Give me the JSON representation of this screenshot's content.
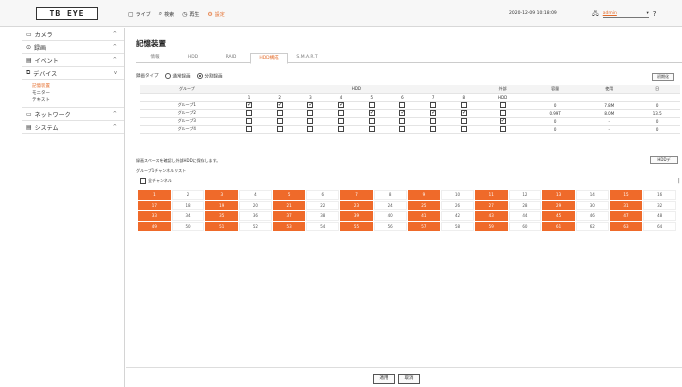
{
  "topbar": {
    "logo": "TB EYE",
    "nav": [
      {
        "icon": "live-icon",
        "glyph": "▢",
        "label": "ライブ",
        "active": false
      },
      {
        "icon": "search-icon",
        "glyph": "⌕",
        "label": "検索",
        "active": false
      },
      {
        "icon": "playback-icon",
        "glyph": "◷",
        "label": "再生",
        "active": false
      },
      {
        "icon": "settings-icon",
        "glyph": "⚙",
        "label": "設定",
        "active": true
      }
    ],
    "datetime": "2020-12-09 10:18:09",
    "user": "admin",
    "help": "?"
  },
  "sidebar": {
    "groups": [
      {
        "label": "カメラ",
        "glyph": "▭",
        "chevron": "^",
        "items": []
      },
      {
        "label": "録画",
        "glyph": "⊙",
        "chevron": "^",
        "items": []
      },
      {
        "label": "イベント",
        "glyph": "▤",
        "chevron": "^",
        "items": []
      },
      {
        "label": "デバイス",
        "glyph": "⧉",
        "chevron": "v",
        "items": [
          {
            "label": "記憶装置",
            "active": true
          },
          {
            "label": "モニター",
            "active": false
          },
          {
            "label": "テキスト",
            "active": false
          }
        ]
      },
      {
        "label": "ネットワーク",
        "glyph": "▭",
        "chevron": "^",
        "items": []
      },
      {
        "label": "システム",
        "glyph": "▤",
        "chevron": "^",
        "items": []
      }
    ]
  },
  "main": {
    "title": "記憶装置",
    "tabs": [
      {
        "label": "情報",
        "active": false
      },
      {
        "label": "HDD",
        "active": false
      },
      {
        "label": "RAID",
        "active": false
      },
      {
        "label": "HDD構成",
        "active": true
      },
      {
        "label": "S.M.A.R.T",
        "active": false
      }
    ],
    "mode_label": "録画タイプ",
    "mode_options": [
      {
        "label": "通常録画",
        "selected": false
      },
      {
        "label": "分割録画",
        "selected": true
      }
    ],
    "init_button": "初期化",
    "table": {
      "group_header": "グループ",
      "hdd_header": "HDD",
      "external_header": "外部",
      "external_sub": "HDD",
      "cols": [
        "1",
        "2",
        "3",
        "4",
        "5",
        "6",
        "7",
        "8"
      ],
      "extra_headers": [
        "容量",
        "使用",
        "日"
      ],
      "rows": [
        {
          "label": "グループ1",
          "checks": [
            true,
            true,
            true,
            true,
            false,
            false,
            false,
            false
          ],
          "external": false,
          "values": [
            "0",
            "7.8M",
            "0"
          ]
        },
        {
          "label": "グループ2",
          "checks": [
            false,
            false,
            false,
            false,
            true,
            true,
            true,
            true
          ],
          "external": false,
          "values": [
            "0.99T",
            "8.0M",
            "13.5"
          ]
        },
        {
          "label": "グループ3",
          "checks": [
            false,
            false,
            false,
            false,
            false,
            false,
            false,
            false
          ],
          "external": true,
          "values": [
            "0",
            "-",
            "0"
          ]
        },
        {
          "label": "グループ4",
          "checks": [
            false,
            false,
            false,
            false,
            false,
            false,
            false,
            false
          ],
          "external": false,
          "values": [
            "0",
            "-",
            "0"
          ]
        }
      ]
    },
    "note": "録画スペースを確認し外部HDDに保存します。",
    "hdd_button": "HDDデ",
    "channel_label": "グループ1チャンネルリスト",
    "all_channels": "全チャンネル",
    "channels": [
      {
        "n": "1",
        "on": true
      },
      {
        "n": "2",
        "on": false
      },
      {
        "n": "3",
        "on": true
      },
      {
        "n": "4",
        "on": false
      },
      {
        "n": "5",
        "on": true
      },
      {
        "n": "6",
        "on": false
      },
      {
        "n": "7",
        "on": true
      },
      {
        "n": "8",
        "on": false
      },
      {
        "n": "9",
        "on": true
      },
      {
        "n": "10",
        "on": false
      },
      {
        "n": "11",
        "on": true
      },
      {
        "n": "12",
        "on": false
      },
      {
        "n": "13",
        "on": true
      },
      {
        "n": "14",
        "on": false
      },
      {
        "n": "15",
        "on": true
      },
      {
        "n": "16",
        "on": false
      },
      {
        "n": "17",
        "on": true
      },
      {
        "n": "18",
        "on": false
      },
      {
        "n": "19",
        "on": true
      },
      {
        "n": "20",
        "on": false
      },
      {
        "n": "21",
        "on": true
      },
      {
        "n": "22",
        "on": false
      },
      {
        "n": "23",
        "on": true
      },
      {
        "n": "24",
        "on": false
      },
      {
        "n": "25",
        "on": true
      },
      {
        "n": "26",
        "on": false
      },
      {
        "n": "27",
        "on": true
      },
      {
        "n": "28",
        "on": false
      },
      {
        "n": "29",
        "on": true
      },
      {
        "n": "30",
        "on": false
      },
      {
        "n": "31",
        "on": true
      },
      {
        "n": "32",
        "on": false
      },
      {
        "n": "33",
        "on": true
      },
      {
        "n": "34",
        "on": false
      },
      {
        "n": "35",
        "on": true
      },
      {
        "n": "36",
        "on": false
      },
      {
        "n": "37",
        "on": true
      },
      {
        "n": "38",
        "on": false
      },
      {
        "n": "39",
        "on": true
      },
      {
        "n": "40",
        "on": false
      },
      {
        "n": "41",
        "on": true
      },
      {
        "n": "42",
        "on": false
      },
      {
        "n": "43",
        "on": true
      },
      {
        "n": "44",
        "on": false
      },
      {
        "n": "45",
        "on": true
      },
      {
        "n": "46",
        "on": false
      },
      {
        "n": "47",
        "on": true
      },
      {
        "n": "48",
        "on": false
      },
      {
        "n": "49",
        "on": true
      },
      {
        "n": "50",
        "on": false
      },
      {
        "n": "51",
        "on": true
      },
      {
        "n": "52",
        "on": false
      },
      {
        "n": "53",
        "on": true
      },
      {
        "n": "54",
        "on": false
      },
      {
        "n": "55",
        "on": true
      },
      {
        "n": "56",
        "on": false
      },
      {
        "n": "57",
        "on": true
      },
      {
        "n": "58",
        "on": false
      },
      {
        "n": "59",
        "on": true
      },
      {
        "n": "60",
        "on": false
      },
      {
        "n": "61",
        "on": true
      },
      {
        "n": "62",
        "on": false
      },
      {
        "n": "63",
        "on": true
      },
      {
        "n": "64",
        "on": false
      }
    ],
    "apply_button": "適用",
    "cancel_button": "取消"
  },
  "colors": {
    "accent": "#ef6a2a"
  }
}
